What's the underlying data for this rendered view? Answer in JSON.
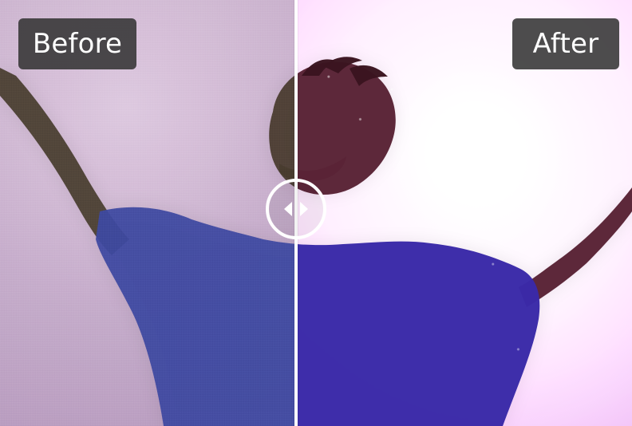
{
  "comparison": {
    "before_label": "Before",
    "after_label": "After",
    "split_fraction": 0.467
  },
  "icons": {
    "handle_left": "chevron-left-icon",
    "handle_right": "chevron-right-icon"
  },
  "colors": {
    "label_bg": "#343434",
    "label_text": "#ffffff",
    "divider": "#ffffff",
    "shirt_before": "#3f4aa1",
    "shirt_after": "#3a2aa8",
    "skin_before": "#4c4130",
    "skin_after": "#5a2436"
  }
}
